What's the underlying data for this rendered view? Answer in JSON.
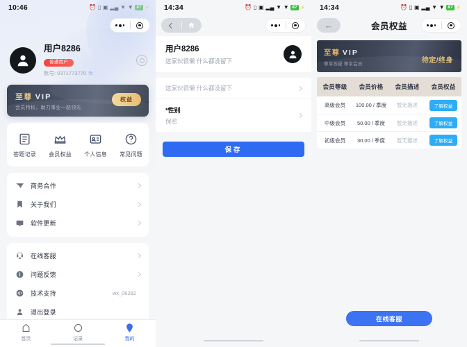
{
  "panels": {
    "profile": {
      "status": {
        "time": "10:46",
        "battery": "87"
      },
      "user": {
        "name": "用户8286",
        "badge": "普通用户",
        "account": "账号: 0371773770",
        "avatar_icon": "person-icon",
        "settings_icon": "settings-ring-icon",
        "copy_icon": "copy-icon"
      },
      "vip_card": {
        "title_cn": "至尊",
        "title_en": "VIP",
        "subtitle": "会员特权，助力事业一路领先",
        "button": "权益"
      },
      "grid": [
        {
          "label": "答题记录",
          "icon": "document-list-icon"
        },
        {
          "label": "会员权益",
          "icon": "crown-icon"
        },
        {
          "label": "个人信息",
          "icon": "id-card-icon"
        },
        {
          "label": "常见问题",
          "icon": "question-circle-icon"
        }
      ],
      "menu_group_1": [
        {
          "label": "商务合作",
          "icon": "paper-plane-icon",
          "value": "",
          "chevron": true
        },
        {
          "label": "关于我们",
          "icon": "bookmark-icon",
          "value": "",
          "chevron": true
        },
        {
          "label": "软件更新",
          "icon": "message-icon",
          "value": "",
          "chevron": true
        }
      ],
      "menu_group_2": [
        {
          "label": "在线客服",
          "icon": "headset-icon",
          "value": "",
          "chevron": true
        },
        {
          "label": "问题反馈",
          "icon": "info-circle-icon",
          "value": "",
          "chevron": true
        },
        {
          "label": "技术支持",
          "icon": "code-circle-icon",
          "value": "wx_06282",
          "chevron": false
        },
        {
          "label": "退出登录",
          "icon": "logout-person-icon",
          "value": "",
          "chevron": false
        }
      ],
      "tabs": [
        {
          "label": "首页",
          "icon": "home-icon",
          "active": false
        },
        {
          "label": "记录",
          "icon": "record-circle-icon",
          "active": false
        },
        {
          "label": "我的",
          "icon": "profile-pin-icon",
          "active": true
        }
      ]
    },
    "edit": {
      "status": {
        "time": "14:34",
        "battery": "87"
      },
      "nav": {
        "back_icon": "chevron-left-icon",
        "home_icon": "home-icon"
      },
      "header": {
        "name": "用户8286",
        "subtitle": "这家伙很懒 什么都没留下",
        "avatar_icon": "person-icon"
      },
      "fields": [
        {
          "label": "",
          "value": "这家伙很懒 什么都没留下",
          "required": false,
          "chevron": true
        },
        {
          "label": "*性别",
          "value": "保密",
          "required": true,
          "chevron": true
        }
      ],
      "save_label": "保存"
    },
    "benefits": {
      "status": {
        "time": "14:34",
        "battery": "87"
      },
      "title": "会员权益",
      "nav": {
        "back_icon": "arrow-left-icon"
      },
      "banner": {
        "title_cn": "至尊",
        "title_en": "VIP",
        "subtitle": "尊享答疑 尊享会员",
        "right": "待定/终身"
      },
      "table": {
        "headers": [
          "会员等级",
          "会员价格",
          "会员描述",
          "会员权益"
        ],
        "rows": [
          {
            "level": "高级会员",
            "price": "100.00 / 季度",
            "desc": "暂无描述",
            "action": "了解权益"
          },
          {
            "level": "中级会员",
            "price": "50.00 / 季度",
            "desc": "暂无描述",
            "action": "了解权益"
          },
          {
            "level": "初级会员",
            "price": "30.00 / 季度",
            "desc": "暂无描述",
            "action": "了解权益"
          }
        ]
      },
      "service_button": "在线客服"
    }
  },
  "colors": {
    "accent_blue": "#3b73f3",
    "save_blue": "#2f6bf2",
    "table_button": "#2eacf5",
    "badge_red": "#f4443c",
    "gold": "#e6c489",
    "table_header_bg": "#e4ddd6"
  }
}
